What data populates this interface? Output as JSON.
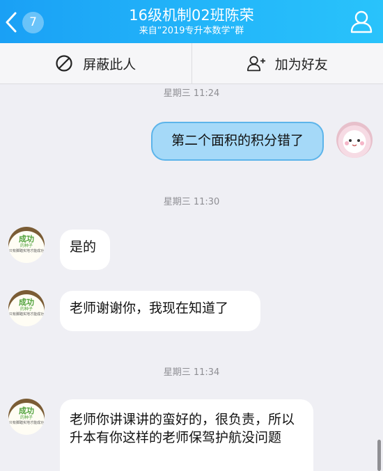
{
  "header": {
    "back_badge_count": "7",
    "title": "16级机制02班陈荣",
    "subtitle": "来自“2019专升本数学”群"
  },
  "actions": {
    "block_label": "屏蔽此人",
    "add_friend_label": "加为好友"
  },
  "avatar_text": {
    "line1": "成功",
    "line2": "的种子",
    "line3": "只有脚踏实地才能成功"
  },
  "messages": [
    {
      "timestamp": "星期三 11:24"
    },
    {
      "side": "outgoing",
      "text": "第二个面积的积分错了"
    },
    {
      "timestamp": "星期三 11:30"
    },
    {
      "side": "incoming",
      "text": "是的"
    },
    {
      "side": "incoming",
      "text": "老师谢谢你，我现在知道了"
    },
    {
      "timestamp": "星期三 11:34"
    },
    {
      "side": "incoming",
      "text": "老师你讲课讲的蛮好的，很负责，所以升本有你这样的老师保驾护航没问题"
    }
  ],
  "colors": {
    "header_start": "#1aa0f5",
    "header_end": "#29c3fb",
    "outgoing_bubble": "#a5d9f8",
    "background": "#efeff4"
  }
}
